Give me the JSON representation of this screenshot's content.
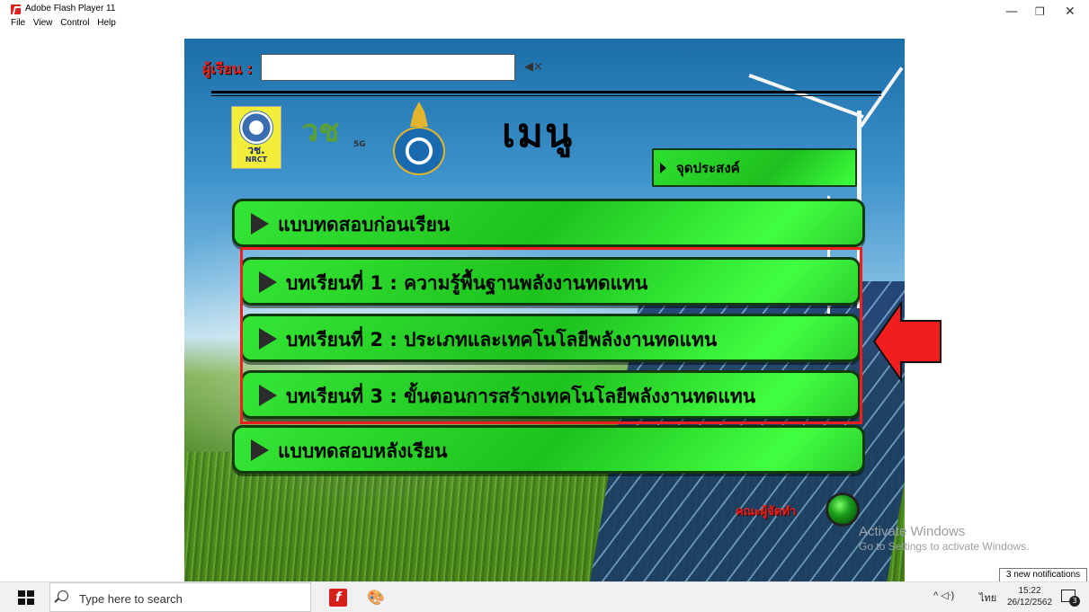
{
  "window": {
    "title": "Adobe Flash Player 11",
    "minimize": "—",
    "restore": "❐",
    "close": "✕"
  },
  "menubar": [
    "File",
    "View",
    "Control",
    "Help"
  ],
  "stage": {
    "learner_label": "ผู้เรียน :",
    "learner_value": "",
    "speaker_icon": "speaker-muted-icon",
    "menu_title": "เมนู",
    "logo_nrct_line1": "วช.",
    "logo_nrct_line2": "NRCT",
    "logo_5g_mark": "วช",
    "logo_5g_badge": "5G",
    "objective_button": "จุดประสงค์",
    "menu_items": [
      "แบบทดสอบก่อนเรียน",
      "บทเรียนที่ 1 :  ความรู้พื้นฐานพลังงานทดแทน",
      "บทเรียนที่ 2 :  ประเภทและเทคโนโลยีพลังงานทดแทน",
      "บทเรียนที่ 3 :  ขั้นตอนการสร้างเทคโนโลยีพลังงานทดแทน",
      "แบบทดสอบหลังเรียน"
    ],
    "credits_label": "คณะผู้จัดทำ",
    "highlight_color": "#f21e1e",
    "button_color": "#22cc22"
  },
  "overlay": {
    "activate_title": "Activate Windows",
    "activate_sub": "Go to Settings to activate Windows.",
    "notification_badge": "3 new notifications"
  },
  "taskbar": {
    "search_placeholder": "Type here to search",
    "tray_language": "ไทย",
    "tray_symbols": "^ ◁ᐧ)",
    "clock_time": "15:22",
    "clock_date": "26/12/2562",
    "notification_count": "3"
  }
}
